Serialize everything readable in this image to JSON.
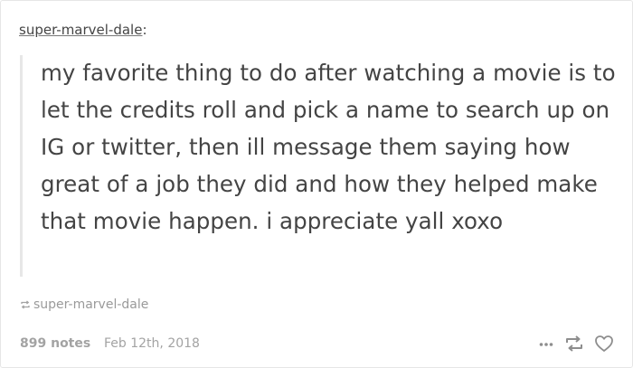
{
  "post": {
    "username": "super-marvel-dale",
    "username_suffix": ":",
    "quote": "my favorite thing to do after watching a movie is to let the credits roll and pick a name to search up on IG or twitter, then ill message them saying how great of a job they did and how they helped make that movie happen. i appreciate yall xoxo",
    "source_label": "super-marvel-dale"
  },
  "footer": {
    "notes": "899 notes",
    "date": "Feb 12th, 2018"
  },
  "icons": {
    "source": "reblog-small-icon",
    "more": "more-dots-icon",
    "reblog": "reblog-icon",
    "like": "heart-icon"
  },
  "colors": {
    "text": "#444444",
    "muted": "#a3a3a3",
    "quote_bar": "#e7e7e7",
    "border": "#e6e6e6"
  }
}
